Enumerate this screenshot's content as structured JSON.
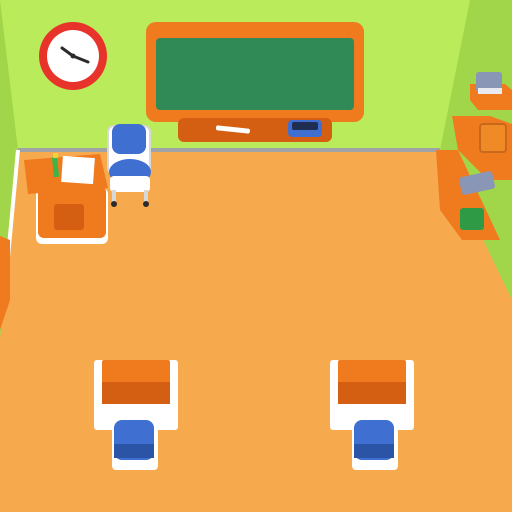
{
  "scene": {
    "title": "",
    "colors": {
      "wall": "#b9eb5a",
      "wall_shade": "#a2d64a",
      "floor": "#f7a94e",
      "floor_edge": "#e58f36",
      "trim": "#ffffff",
      "furniture_orange": "#f07a1e",
      "furniture_orange_dark": "#d45f12",
      "chalkboard": "#2f8a55",
      "chair_blue": "#3e6fd1",
      "chair_blue_dark": "#2c54a6",
      "clock_face": "#ffffff",
      "clock_rim": "#e8332b"
    },
    "objects": [
      {
        "name": "wall-clock",
        "icon": "clock-icon"
      },
      {
        "name": "chalkboard",
        "icon": "chalkboard-icon"
      },
      {
        "name": "chalk-piece",
        "icon": "chalk-icon"
      },
      {
        "name": "board-eraser",
        "icon": "eraser-icon"
      },
      {
        "name": "teacher-desk",
        "icon": "podium-icon"
      },
      {
        "name": "teacher-chair",
        "icon": "chair-icon"
      },
      {
        "name": "wall-shelf-top",
        "icon": "shelf-icon"
      },
      {
        "name": "wall-shelf-middle",
        "icon": "shelf-icon"
      },
      {
        "name": "wall-shelf-bottom",
        "icon": "shelf-icon"
      },
      {
        "name": "student-desk-left",
        "icon": "desk-icon"
      },
      {
        "name": "student-chair-left",
        "icon": "chair-icon"
      },
      {
        "name": "student-desk-right",
        "icon": "desk-icon"
      },
      {
        "name": "student-chair-right",
        "icon": "chair-icon"
      }
    ]
  }
}
